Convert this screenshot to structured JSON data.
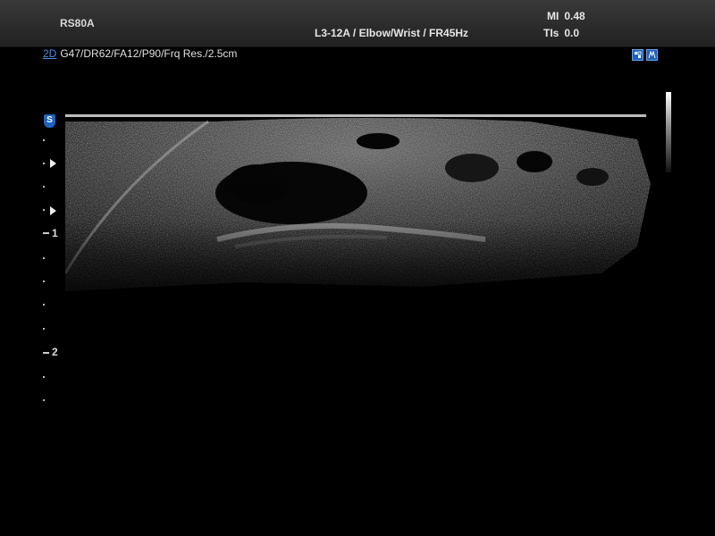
{
  "header": {
    "device": "RS80A",
    "probe_preset": "L3-12A / Elbow/Wrist / FR45Hz",
    "mi_label": "MI",
    "mi_value": "0.48",
    "tis_label": "TIs",
    "tis_value": "0.0"
  },
  "params": {
    "mode": "2D",
    "text": "G47/DR62/FA12/P90/Frq Res./2.5cm"
  },
  "scale": {
    "badge": "S",
    "depth_1": "1",
    "depth_2": "2"
  },
  "colors": {
    "accent": "#1e63c0",
    "mode_link": "#4f8fe0"
  },
  "icons": [
    "freeze-status-icon",
    "measure-status-icon"
  ]
}
